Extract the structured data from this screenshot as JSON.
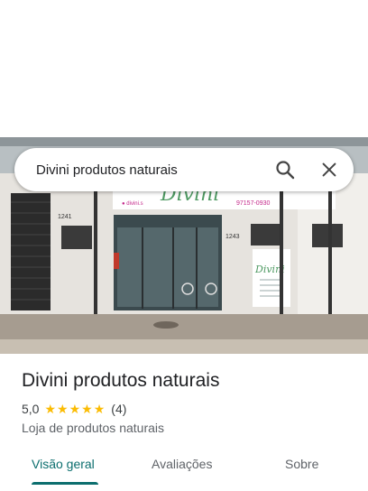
{
  "search": {
    "query": "Divini produtos naturais"
  },
  "photo": {
    "sign_name": "Divini",
    "sign_phone": "97157-0930",
    "number_left": "1241",
    "number_right": "1243",
    "store_logo": "Divini"
  },
  "place": {
    "title": "Divini produtos naturais",
    "rating": "5,0",
    "stars": 5,
    "reviews": "(4)",
    "category": "Loja de produtos naturais"
  },
  "tabs": [
    {
      "label": "Visão geral",
      "active": true
    },
    {
      "label": "Avaliações",
      "active": false
    },
    {
      "label": "Sobre",
      "active": false
    }
  ],
  "colors": {
    "accent": "#0b6e6e",
    "star": "#fbbc04",
    "text": "#202124"
  },
  "icons": {
    "search": "search-icon",
    "close": "close-icon",
    "star": "star-icon"
  }
}
